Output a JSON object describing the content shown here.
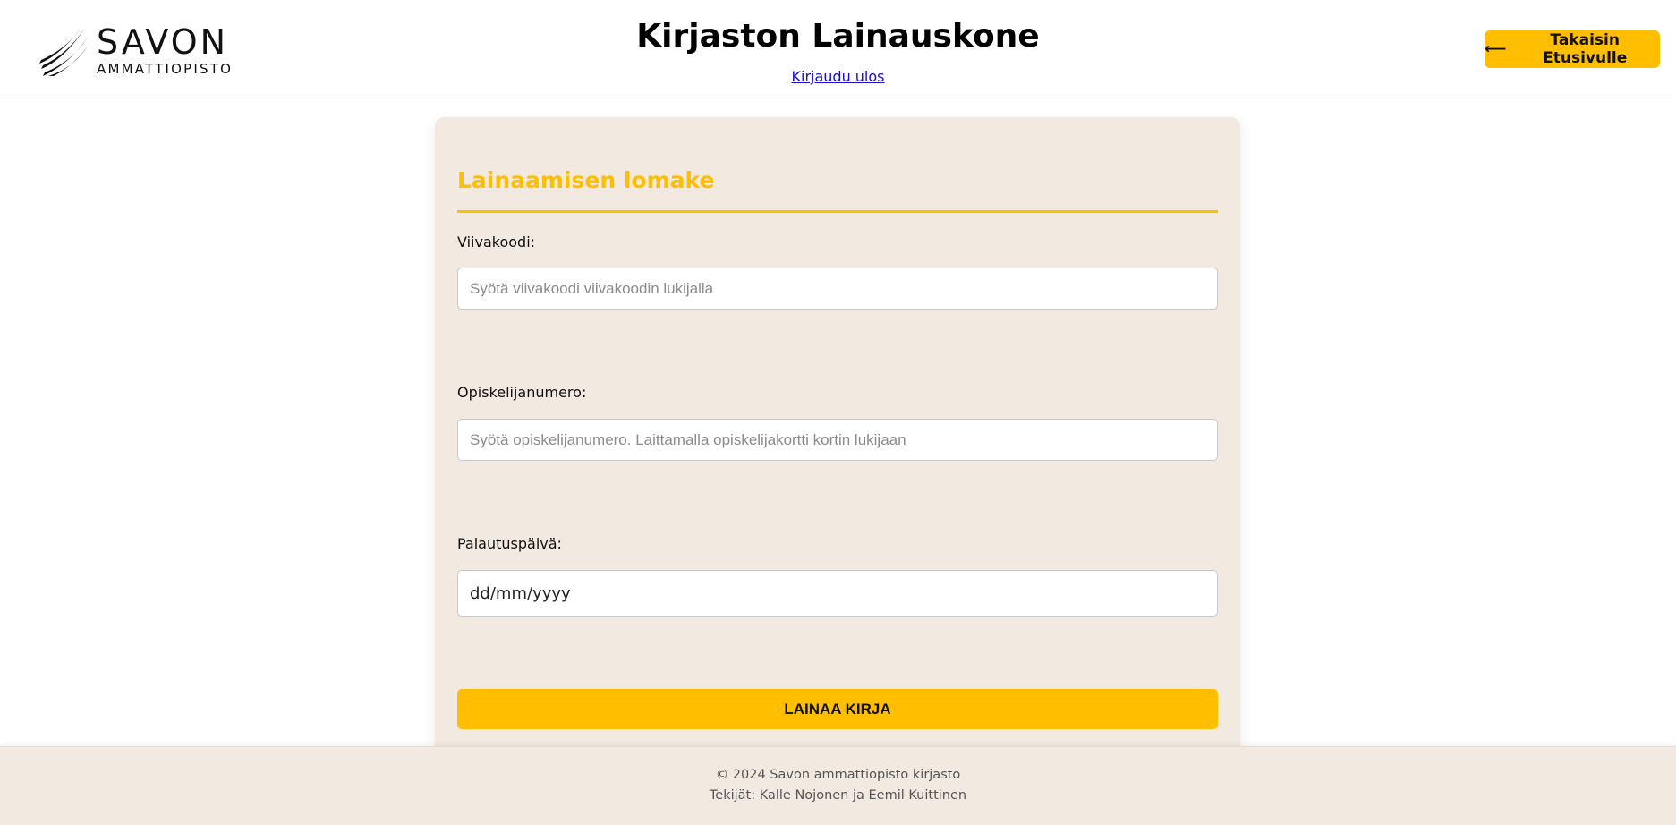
{
  "header": {
    "logo": {
      "main": "SAVON",
      "sub": "AMMATTIOPISTO"
    },
    "title": "Kirjaston Lainauskone",
    "logout_label": "Kirjaudu ulos",
    "back_button": {
      "arrow": "⟵",
      "label": "Takaisin Etusivulle"
    }
  },
  "form": {
    "title": "Lainaamisen lomake",
    "fields": [
      {
        "label": "Viivakoodi:",
        "placeholder": "Syötä viivakoodi viivakoodin lukijalla",
        "value": ""
      },
      {
        "label": "Opiskelijanumero:",
        "placeholder": "Syötä opiskelijanumero. Laittamalla opiskelijakortti kortin lukijaan",
        "value": ""
      },
      {
        "label": "Palautuspäivä:",
        "value": "dd/mm/yyyy"
      }
    ],
    "submit_label": "LAINAA KIRJA"
  },
  "footer": {
    "copyright": "© 2024 Savon ammattiopisto kirjasto",
    "authors": "Tekijät: Kalle Nojonen ja Eemil Kuittinen"
  },
  "colors": {
    "accent": "#ffbf00",
    "card_background": "#f2e9e1",
    "link": "#1a0dcc"
  }
}
